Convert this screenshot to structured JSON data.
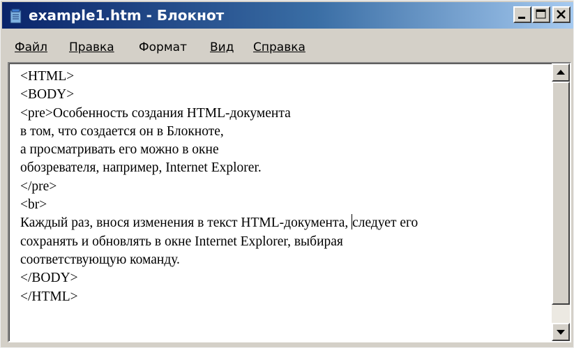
{
  "window": {
    "title": "example1.htm - Блокнот"
  },
  "icons": {
    "app": "notepad-icon",
    "minimize": "minimize-icon",
    "maximize": "maximize-icon",
    "close": "close-icon",
    "scroll_up": "arrow-up-icon",
    "scroll_down": "arrow-down-icon"
  },
  "colors": {
    "titlebar_start": "#0a246a",
    "titlebar_end": "#a6caf0",
    "chrome": "#d4d0c8"
  },
  "menu": {
    "items": [
      {
        "label": "Файл"
      },
      {
        "label": "Правка"
      },
      {
        "label": "Формат"
      },
      {
        "label": "Вид"
      },
      {
        "label": "Справка"
      }
    ]
  },
  "editor": {
    "lines": [
      "<HTML>",
      "<BODY>",
      "<pre>Особенность создания HTML-документа",
      "в том, что создается он в Блокноте,",
      "а просматривать его можно в окне",
      "обозревателя, например, Internet Explorer.",
      "</pre>",
      "<br>",
      "Каждый раз, внося изменения в текст HTML-документа, ",
      "следует его",
      "сохранять и обновлять в окне Internet Explorer, выбирая",
      "соответствующую команду.",
      "</BODY>",
      "</HTML>"
    ]
  }
}
